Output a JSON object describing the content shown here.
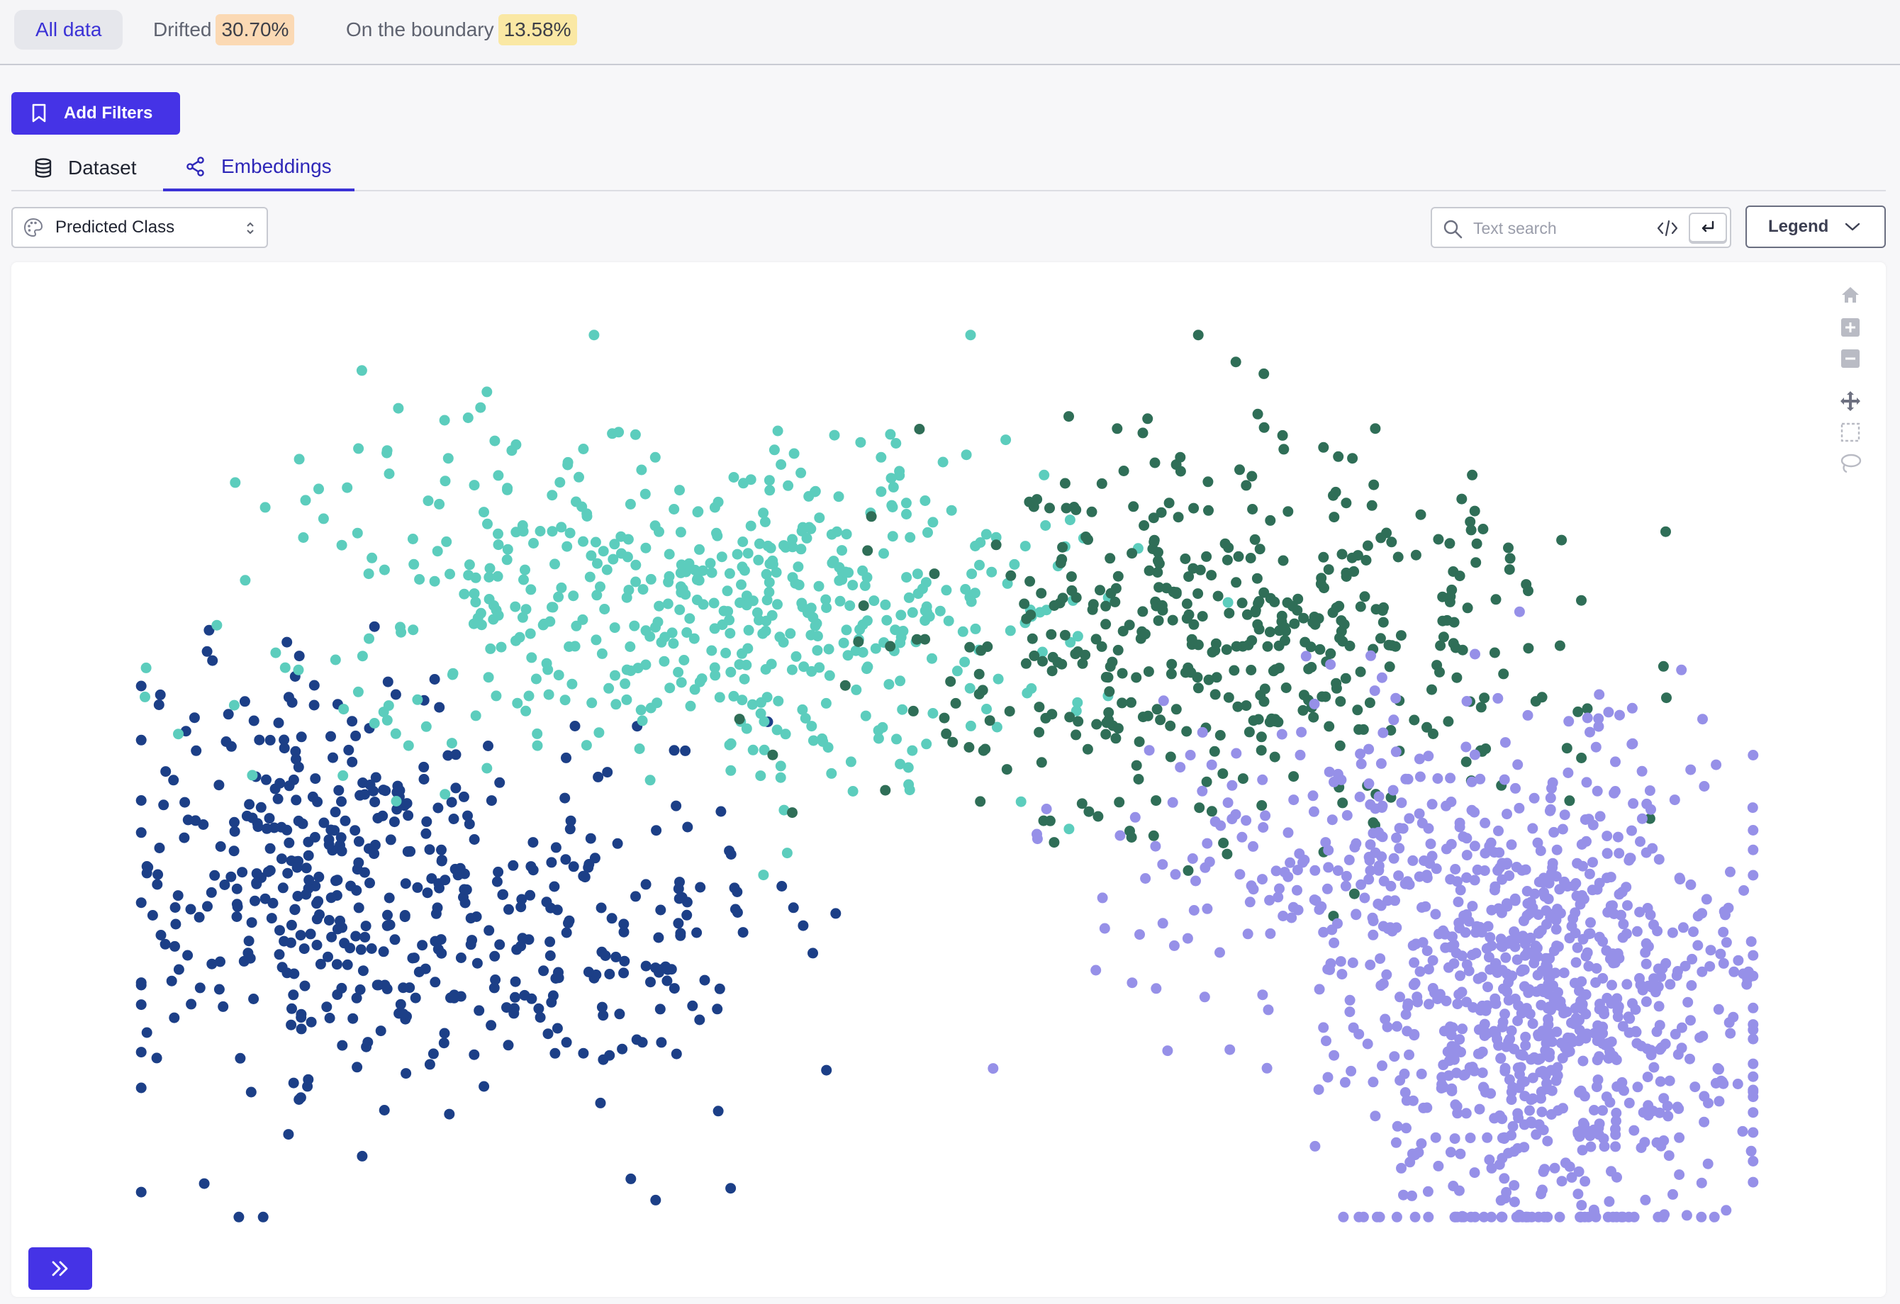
{
  "header": {
    "segments": [
      {
        "label": "All data",
        "badge": ""
      },
      {
        "label": "Drifted",
        "badge": "30.70%"
      },
      {
        "label": "On the boundary",
        "badge": "13.58%"
      }
    ]
  },
  "toolbar": {
    "add_filters_label": "Add Filters"
  },
  "tabs": [
    {
      "label": "Dataset",
      "icon": "database-icon"
    },
    {
      "label": "Embeddings",
      "icon": "share-nodes-icon",
      "active": true
    }
  ],
  "controls": {
    "color_by": {
      "selected": "Predicted Class",
      "icon": "palette-icon"
    },
    "search": {
      "placeholder": "Text search",
      "value": ""
    },
    "legend_label": "Legend"
  },
  "modebar": [
    "home-icon",
    "zoom-in-icon",
    "zoom-out-icon",
    "pan-icon",
    "box-select-icon",
    "lasso-select-icon"
  ],
  "colors": {
    "accent": "#4533e6",
    "drifted_badge": "#fbd9b4",
    "boundary_badge": "#fae8a4",
    "class_navy": "#1c3f87",
    "class_teal": "#5ccdbd",
    "class_green": "#2f6e57",
    "class_lavender": "#9690e8"
  },
  "chart_data": {
    "type": "scatter",
    "x_range": [
      0,
      100
    ],
    "y_range": [
      0,
      100
    ],
    "grid": false,
    "series": [
      {
        "color": "#1c3f87",
        "count": 520,
        "clusters": [
          {
            "cx": 12,
            "cy": 38,
            "sx": 6,
            "sy": 12,
            "w": 0.7
          },
          {
            "cx": 28,
            "cy": 33,
            "sx": 6,
            "sy": 9,
            "w": 0.3
          }
        ]
      },
      {
        "color": "#5ccdbd",
        "count": 560,
        "clusters": [
          {
            "cx": 28,
            "cy": 70,
            "sx": 10,
            "sy": 10,
            "w": 0.55
          },
          {
            "cx": 44,
            "cy": 68,
            "sx": 8,
            "sy": 10,
            "w": 0.45
          }
        ]
      },
      {
        "color": "#2f6e57",
        "count": 460,
        "clusters": [
          {
            "cx": 67,
            "cy": 66,
            "sx": 10,
            "sy": 10,
            "w": 1.0
          }
        ]
      },
      {
        "color": "#9690e8",
        "count": 1100,
        "clusters": [
          {
            "cx": 87,
            "cy": 22,
            "sx": 6,
            "sy": 12,
            "w": 0.7
          },
          {
            "cx": 78,
            "cy": 40,
            "sx": 9,
            "sy": 10,
            "w": 0.3
          }
        ]
      }
    ]
  }
}
